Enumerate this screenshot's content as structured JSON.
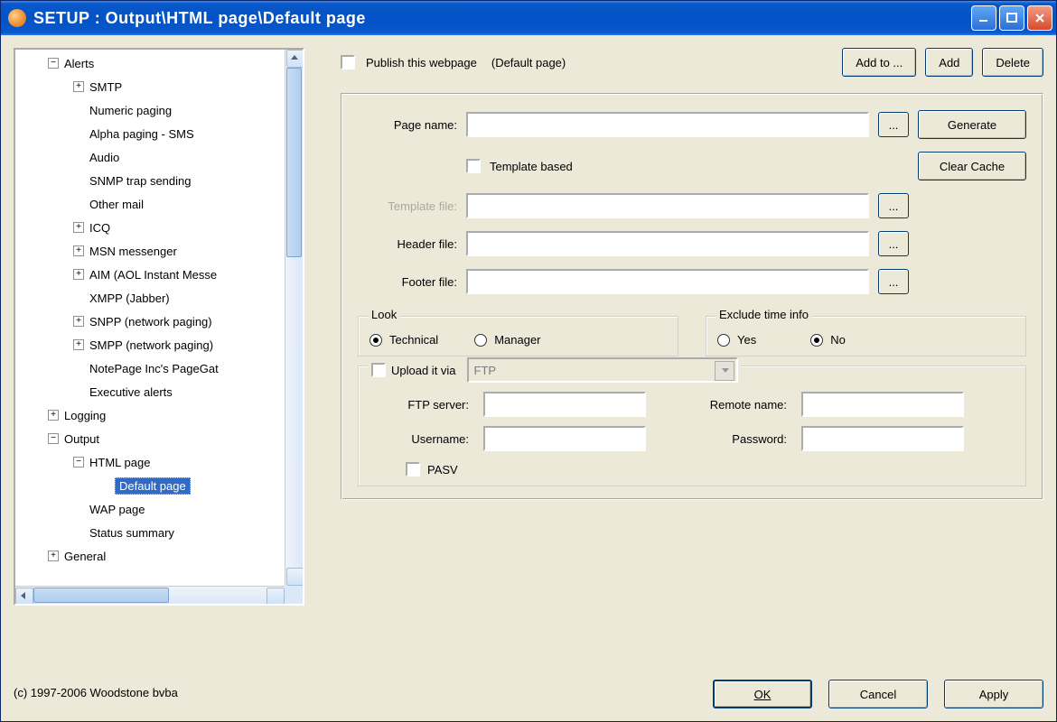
{
  "title": "SETUP : Output\\HTML page\\Default page",
  "tree": {
    "alerts": "Alerts",
    "smtp": "SMTP",
    "numeric_paging": "Numeric paging",
    "alpha_paging": "Alpha paging - SMS",
    "audio": "Audio",
    "snmp_trap": "SNMP trap sending",
    "other_mail": "Other mail",
    "icq": "ICQ",
    "msn": "MSN messenger",
    "aim": "AIM (AOL Instant Messe",
    "xmpp": "XMPP (Jabber)",
    "snpp": "SNPP (network paging)",
    "smpp": "SMPP (network paging)",
    "notepage": "NotePage Inc's PageGat",
    "executive": "Executive alerts",
    "logging": "Logging",
    "output": "Output",
    "html_page": "HTML page",
    "default_page": "Default page",
    "wap_page": "WAP page",
    "status_summary": "Status summary",
    "general": "General"
  },
  "top": {
    "publish": "Publish this webpage",
    "current_page": "(Default page)",
    "add_to": "Add to ...",
    "add": "Add",
    "delete": "Delete"
  },
  "form": {
    "page_name_label": "Page name:",
    "page_name_value": "",
    "browse": "...",
    "generate": "Generate",
    "template_based": "Template based",
    "clear_cache": "Clear Cache",
    "template_file_label": "Template file:",
    "template_file_value": "",
    "header_file_label": "Header file:",
    "header_file_value": "",
    "footer_file_label": "Footer file:",
    "footer_file_value": "",
    "look_legend": "Look",
    "look_technical": "Technical",
    "look_manager": "Manager",
    "exclude_legend": "Exclude time info",
    "exclude_yes": "Yes",
    "exclude_no": "No",
    "upload_legend": "Upload it via",
    "upload_proto": "FTP",
    "ftp_server_label": "FTP server:",
    "ftp_server_value": "",
    "remote_name_label": "Remote name:",
    "remote_name_value": "",
    "username_label": "Username:",
    "username_value": "",
    "password_label": "Password:",
    "password_value": "",
    "pasv": "PASV"
  },
  "buttons": {
    "ok": "OK",
    "cancel": "Cancel",
    "apply": "Apply"
  },
  "copyright": "(c) 1997-2006 Woodstone bvba"
}
